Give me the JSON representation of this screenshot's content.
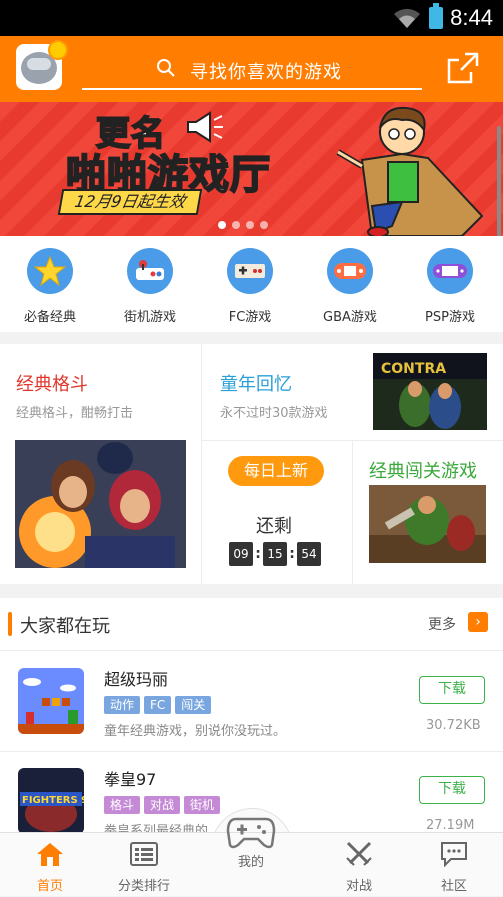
{
  "status_bar": {
    "time": "8:44"
  },
  "header": {
    "search_placeholder": "寻找你喜欢的游戏"
  },
  "banner": {
    "headline_top": "更名",
    "headline_main": "啪啪游戏厅",
    "subtitle": "12月9日起生效"
  },
  "categories": [
    {
      "label": "必备经典",
      "color": "#3f8fe5"
    },
    {
      "label": "街机游戏",
      "color": "#3f8fe5"
    },
    {
      "label": "FC游戏",
      "color": "#3f8fe5"
    },
    {
      "label": "GBA游戏",
      "color": "#3f8fe5"
    },
    {
      "label": "PSP游戏",
      "color": "#3f8fe5"
    }
  ],
  "features": {
    "classic_fight": {
      "title": "经典格斗",
      "subtitle": "经典格斗，酣畅打击"
    },
    "childhood": {
      "title": "童年回忆",
      "subtitle": "永不过时30款游戏"
    },
    "daily": {
      "badge": "每日上新",
      "remaining": "还剩",
      "hours": "09",
      "minutes": "15",
      "seconds": "54"
    },
    "level_games": {
      "title": "经典闯关游戏"
    }
  },
  "popular": {
    "title": "大家都在玩",
    "more": "更多",
    "games": [
      {
        "name": "超级玛丽",
        "tags": [
          "动作",
          "FC",
          "闯关"
        ],
        "desc": "童年经典游戏，别说你没玩过。",
        "size": "30.72KB",
        "download": "下载"
      },
      {
        "name": "拳皇97",
        "tags": [
          "格斗",
          "对战",
          "街机"
        ],
        "desc": "拳皇系列最经典的",
        "size": "27.19M",
        "download": "下载",
        "thumb_text": "FIGHTERS 97"
      }
    ]
  },
  "tabs": [
    {
      "label": "首页"
    },
    {
      "label": "分类排行"
    },
    {
      "label": "我的"
    },
    {
      "label": "对战"
    },
    {
      "label": "社区"
    }
  ],
  "colors": {
    "brand_orange": "#ff7d00",
    "download_green": "#3db24a",
    "tag_blue": "#7aa6e0"
  }
}
